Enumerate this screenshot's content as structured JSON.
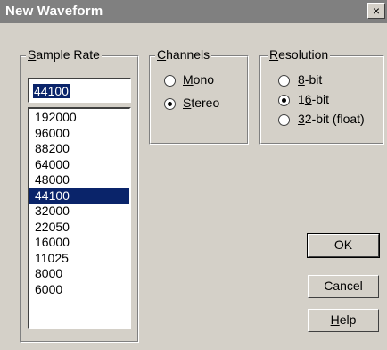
{
  "window": {
    "title": "New Waveform",
    "close_glyph": "×"
  },
  "sample_rate": {
    "legend": "Sample Rate",
    "legend_mnemonic": "S",
    "legend_rest": "ample Rate",
    "value": "44100",
    "options": [
      "192000",
      "96000",
      "88200",
      "64000",
      "48000",
      "44100",
      "32000",
      "22050",
      "16000",
      "11025",
      "8000",
      "6000"
    ],
    "selected_index": 5
  },
  "channels": {
    "legend": "Channels",
    "legend_mnemonic": "C",
    "legend_rest": "hannels",
    "options": [
      {
        "label": "Mono",
        "mnemonic": "M",
        "rest": "ono",
        "checked": false
      },
      {
        "label": "Stereo",
        "mnemonic": "S",
        "rest": "tereo",
        "checked": true
      }
    ]
  },
  "resolution": {
    "legend": "Resolution",
    "legend_mnemonic": "R",
    "legend_rest": "esolution",
    "options": [
      {
        "label": "8-bit",
        "mnemonic": "8",
        "rest": "-bit",
        "checked": false
      },
      {
        "label": "16-bit",
        "pre": "1",
        "mnemonic": "6",
        "rest": "-bit",
        "checked": true
      },
      {
        "label": "32-bit (float)",
        "mnemonic": "3",
        "rest": "2-bit (float)",
        "checked": false
      }
    ]
  },
  "buttons": {
    "ok": "OK",
    "cancel": "Cancel",
    "help_mnemonic": "H",
    "help_rest": "elp"
  },
  "colors": {
    "selection": "#0a246a",
    "face": "#d4d0c8",
    "titlebar": "#808080"
  }
}
